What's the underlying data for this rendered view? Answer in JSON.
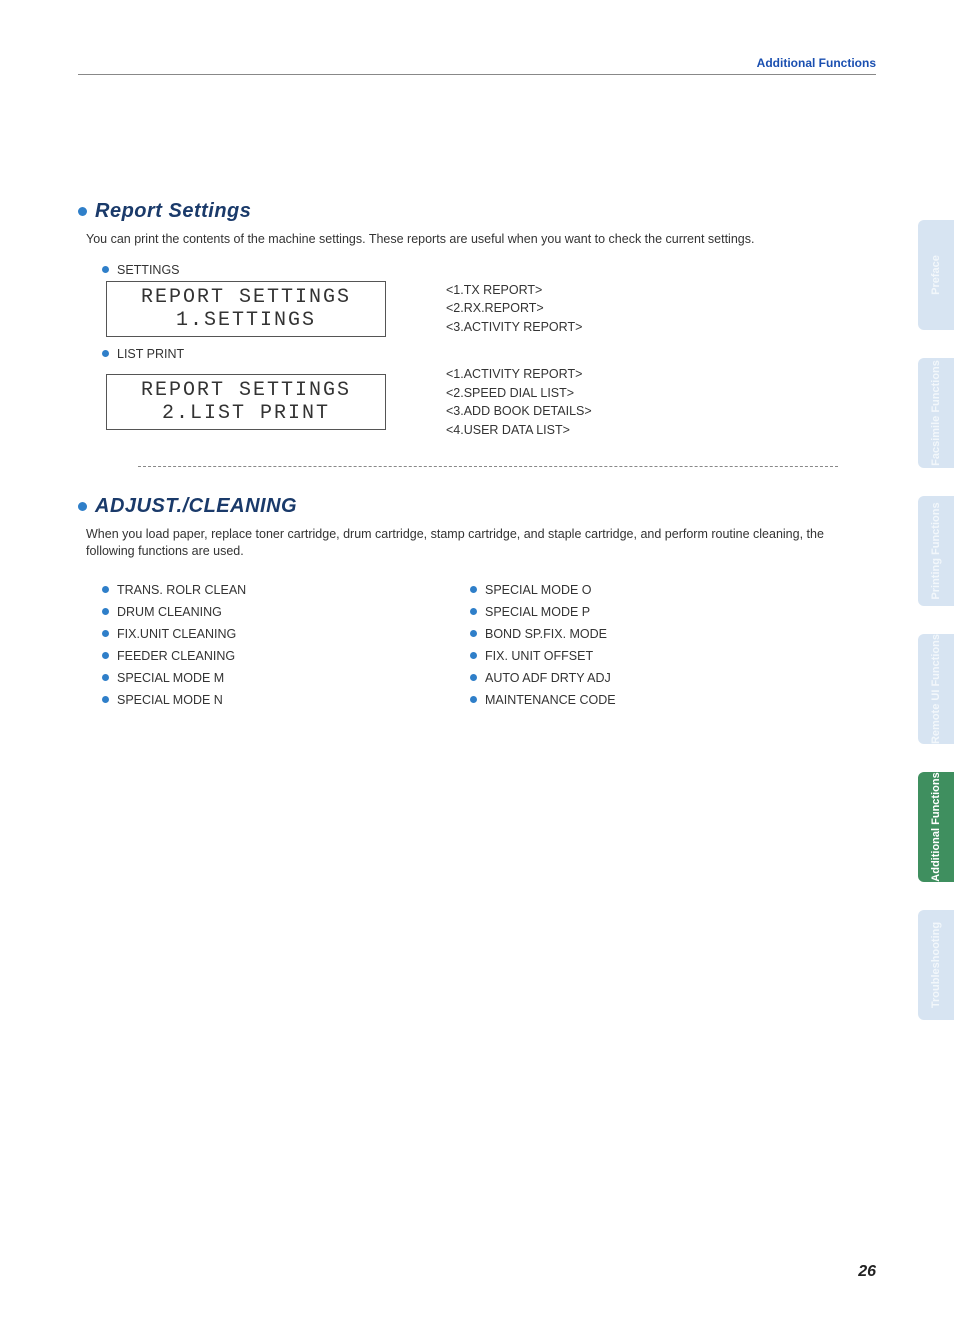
{
  "header": {
    "breadcrumb": "Additional Functions"
  },
  "sideTabs": [
    {
      "label": "Preface",
      "active": false
    },
    {
      "label": "Facsimile Functions",
      "active": false
    },
    {
      "label": "Printing Functions",
      "active": false
    },
    {
      "label": "Remote UI Functions",
      "active": false
    },
    {
      "label": "Additional Functions",
      "active": true
    },
    {
      "label": "Troubleshooting",
      "active": false
    }
  ],
  "section1": {
    "title": "Report Settings",
    "intro": "You can print the contents of the machine settings. These reports are useful when you want to check the current settings.",
    "settings": {
      "label": "SETTINGS",
      "lcd1": "REPORT SETTINGS",
      "lcd2": "1.SETTINGS",
      "options": [
        "<1.TX REPORT>",
        "<2.RX.REPORT>",
        "<3.ACTIVITY REPORT>"
      ]
    },
    "listPrint": {
      "label": "LIST PRINT",
      "lcd1": "REPORT SETTINGS",
      "lcd2": "2.LIST PRINT",
      "options": [
        "<1.ACTIVITY REPORT>",
        "<2.SPEED DIAL LIST>",
        "<3.ADD BOOK DETAILS>",
        "<4.USER DATA LIST>"
      ]
    }
  },
  "section2": {
    "title": "ADJUST./CLEANING",
    "intro": "When you load paper, replace toner cartridge, drum cartridge, stamp cartridge, and staple cartridge, and perform routine cleaning, the following functions are used.",
    "colA": [
      "TRANS. ROLR CLEAN",
      "DRUM CLEANING",
      "FIX.UNIT CLEANING",
      "FEEDER CLEANING",
      "SPECIAL MODE M",
      "SPECIAL MODE N"
    ],
    "colB": [
      "SPECIAL MODE O",
      "SPECIAL MODE P",
      "BOND SP.FIX. MODE",
      "FIX. UNIT OFFSET",
      "AUTO ADF DRTY ADJ",
      "MAINTENANCE CODE"
    ]
  },
  "pageNumber": "26"
}
